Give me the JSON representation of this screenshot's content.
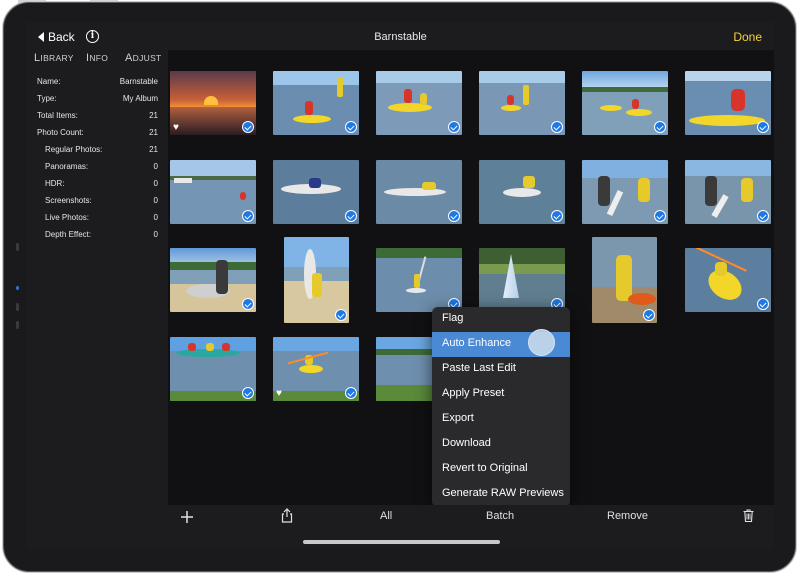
{
  "topbar": {
    "back_label": "Back",
    "info_glyph": "i",
    "title": "Barnstable",
    "done_label": "Done"
  },
  "sidebar": {
    "tabs": [
      {
        "first": "L",
        "rest": "IBRARY"
      },
      {
        "first": "I",
        "rest": "NFO"
      },
      {
        "first": "A",
        "rest": "DJUST"
      }
    ],
    "selected_tab": "INFO",
    "properties": [
      {
        "key": "Name:",
        "value": "Barnstable"
      },
      {
        "key": "Type:",
        "value": "My Album"
      },
      {
        "key": "Total Items:",
        "value": "21"
      },
      {
        "key": "Photo Count:",
        "value": "21"
      },
      {
        "key": "Regular Photos:",
        "value": "21"
      },
      {
        "key": "Panoramas:",
        "value": "0"
      },
      {
        "key": "HDR:",
        "value": "0"
      },
      {
        "key": "Screenshots:",
        "value": "0"
      },
      {
        "key": "Live Photos:",
        "value": "0"
      },
      {
        "key": "Depth Effect:",
        "value": "0"
      }
    ]
  },
  "context_menu": {
    "items": [
      {
        "label": "Flag"
      },
      {
        "label": "Auto Enhance"
      },
      {
        "label": "Paste Last Edit"
      },
      {
        "label": "Apply Preset"
      },
      {
        "label": "Export"
      },
      {
        "label": "Download"
      },
      {
        "label": "Revert to Original"
      },
      {
        "label": "Generate RAW Previews"
      }
    ],
    "highlighted_item": "Auto Enhance"
  },
  "toolbar": {
    "add_icon": "plus-icon",
    "share_icon": "share-icon",
    "all_label": "All",
    "batch_label": "Batch",
    "remove_label": "Remove",
    "trash_icon": "trash-icon"
  },
  "colors": {
    "accent_blue": "#1e78e6",
    "done_yellow": "#f5d33d",
    "info_tab_blue": "#6aa9ff",
    "menu_highlight": "#4a8ad4"
  }
}
